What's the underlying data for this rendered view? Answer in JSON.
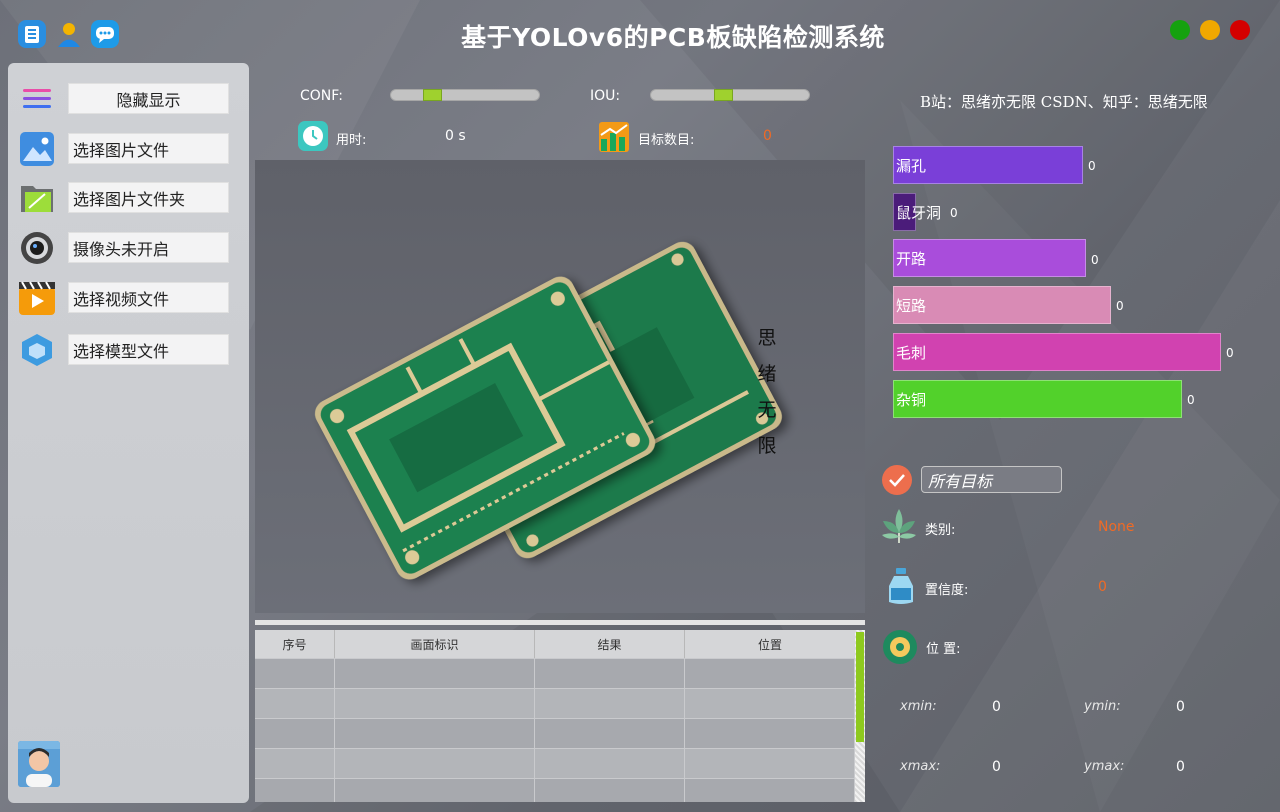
{
  "app_title": "基于YOLOv6的PCB板缺陷检测系统",
  "titlebar_icons": [
    "book-icon",
    "user-icon",
    "chat-icon"
  ],
  "window_buttons": [
    {
      "name": "maximize-button",
      "color": "#15a10f"
    },
    {
      "name": "minimize-button",
      "color": "#f0a800"
    },
    {
      "name": "close-button",
      "color": "#d40000"
    }
  ],
  "sidebar": {
    "toggle_label": "隐藏显示",
    "items": [
      {
        "label": "选择图片文件",
        "icon": "image-icon"
      },
      {
        "label": "选择图片文件夹",
        "icon": "folder-icon"
      },
      {
        "label": "摄像头未开启",
        "icon": "camera-icon"
      },
      {
        "label": "选择视频文件",
        "icon": "video-icon"
      },
      {
        "label": "选择模型文件",
        "icon": "model-icon"
      }
    ]
  },
  "controls": {
    "conf_label": "CONF:",
    "conf_value": 0.25,
    "iou_label": "IOU:",
    "iou_value": 0.45,
    "credit": "B站：思绪亦无限  CSDN、知乎：思绪无限"
  },
  "stats": {
    "time_label": "用时:",
    "time_value": "0 s",
    "count_label": "目标数目:",
    "count_value": "0"
  },
  "watermark": [
    "思",
    "绪",
    "无",
    "限"
  ],
  "table": {
    "headers": [
      "序号",
      "画面标识",
      "结果",
      "位置"
    ],
    "rows": [
      [
        "",
        "",
        "",
        ""
      ],
      [
        "",
        "",
        "",
        ""
      ],
      [
        "",
        "",
        "",
        ""
      ],
      [
        "",
        "",
        "",
        ""
      ],
      [
        "",
        "",
        "",
        ""
      ]
    ]
  },
  "classes": [
    {
      "label": "漏孔",
      "count": "0",
      "color": "#7a3fd8"
    },
    {
      "label": "鼠牙洞",
      "count": "0",
      "color": "#4b1c7a"
    },
    {
      "label": "开路",
      "count": "0",
      "color": "#a94ddb"
    },
    {
      "label": "短路",
      "count": "0",
      "color": "#d98bb5"
    },
    {
      "label": "毛刺",
      "count": "0",
      "color": "#d142b0"
    },
    {
      "label": "杂铜",
      "count": "0",
      "color": "#52d12b"
    }
  ],
  "details": {
    "filter_value": "所有目标",
    "class_label": "类别:",
    "class_value": "None",
    "conf_label": "置信度:",
    "conf_value": "0",
    "pos_label": "位 置:",
    "xmin_label": "xmin:",
    "xmin_value": "0",
    "ymin_label": "ymin:",
    "ymin_value": "0",
    "xmax_label": "xmax:",
    "xmax_value": "0",
    "ymax_label": "ymax:",
    "ymax_value": "0"
  }
}
